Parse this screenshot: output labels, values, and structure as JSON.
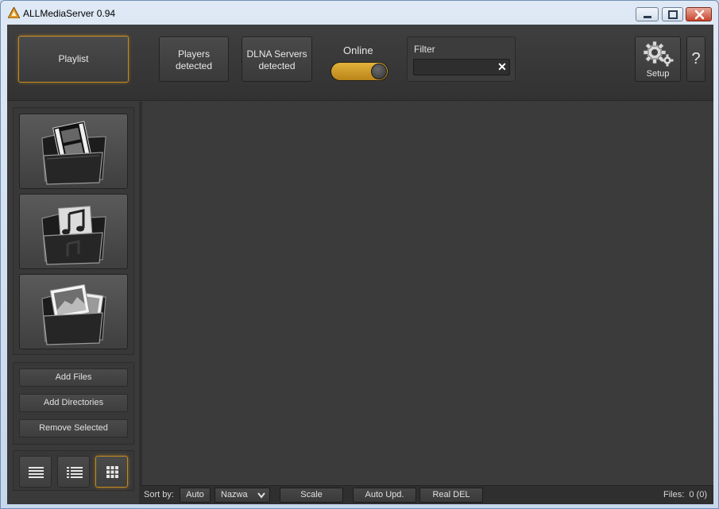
{
  "window": {
    "title": "ALLMediaServer 0.94"
  },
  "toolbar": {
    "playlist_label": "Playlist",
    "players_line1": "Players",
    "players_line2": "detected",
    "dlna_line1": "DLNA Servers",
    "dlna_line2": "detected",
    "online_label": "Online",
    "online_toggle_on": true,
    "filter_label": "Filter",
    "filter_value": "",
    "setup_label": "Setup",
    "help_label": "?"
  },
  "sidebar": {
    "media_buttons": [
      "video-folder-icon",
      "music-folder-icon",
      "pictures-folder-icon"
    ],
    "add_files_label": "Add Files",
    "add_directories_label": "Add Directories",
    "remove_selected_label": "Remove Selected",
    "view_modes": [
      "list-view-icon",
      "details-view-icon",
      "grid-view-icon"
    ],
    "active_view": "grid-view-icon"
  },
  "statusbar": {
    "sort_by_label": "Sort by:",
    "auto_label": "Auto",
    "sort_selected": "Nazwa",
    "scale_label": "Scale",
    "auto_upd_label": "Auto Upd.",
    "real_del_label": "Real DEL",
    "files_label": "Files:",
    "files_count": "0 (0)"
  },
  "colors": {
    "accent": "#e3b23a",
    "background": "#3a3a3a"
  }
}
